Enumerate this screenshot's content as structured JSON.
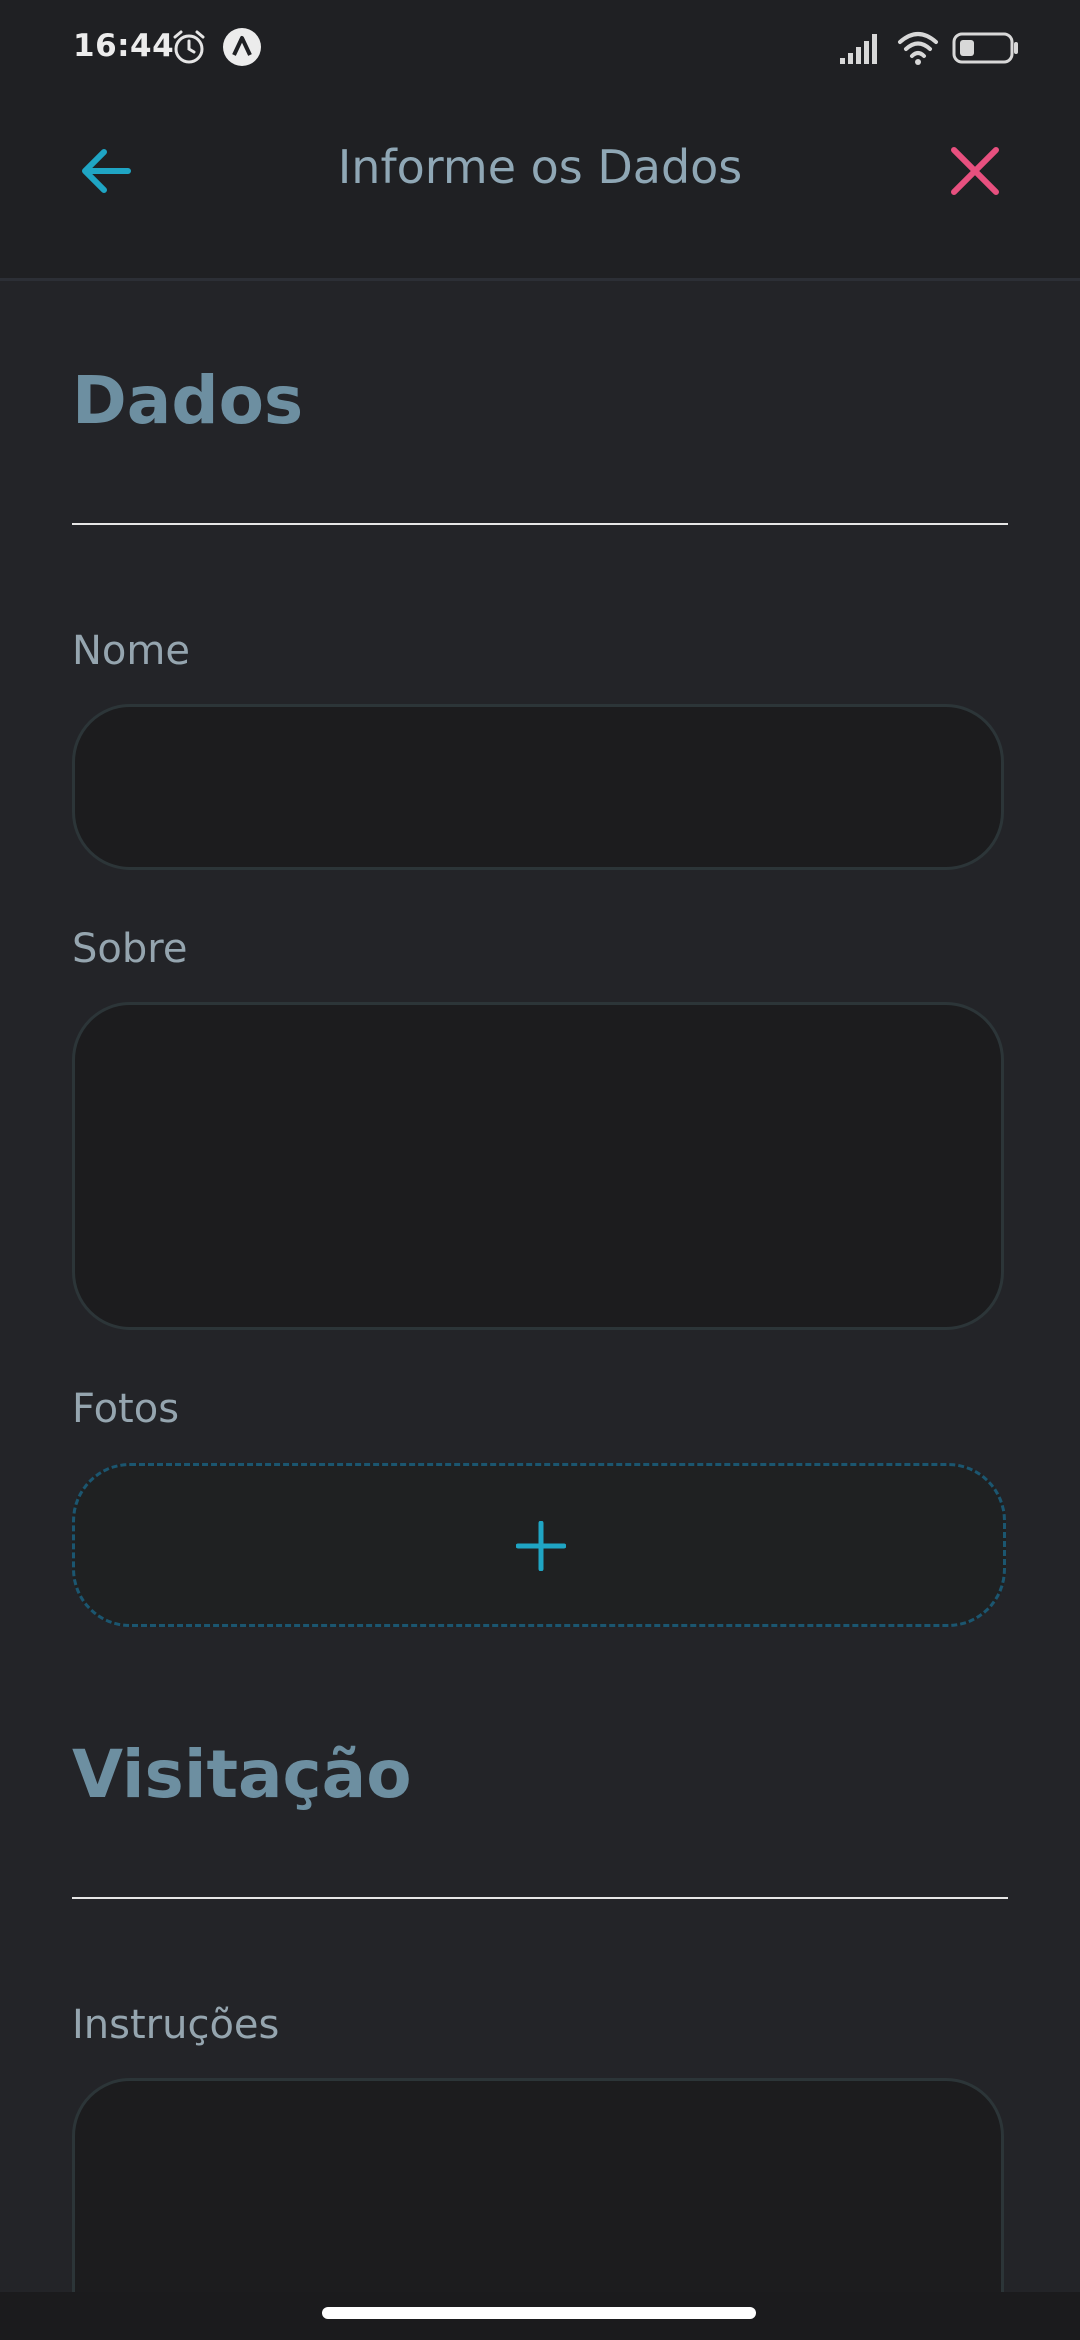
{
  "status_bar": {
    "time": "16:44",
    "icons": [
      "alarm-icon",
      "app-notification-icon",
      "signal-icon",
      "wifi-icon",
      "battery-icon"
    ]
  },
  "header": {
    "title": "Informe os Dados",
    "back_icon": "arrow-left-icon",
    "close_icon": "close-icon"
  },
  "sections": {
    "dados": {
      "title": "Dados",
      "fields": {
        "nome": {
          "label": "Nome",
          "value": ""
        },
        "sobre": {
          "label": "Sobre",
          "value": ""
        },
        "fotos": {
          "label": "Fotos",
          "add_icon": "plus-icon"
        }
      }
    },
    "visitacao": {
      "title": "Visitação",
      "fields": {
        "instrucoes": {
          "label": "Instruções",
          "value": ""
        }
      }
    }
  },
  "colors": {
    "accent": "#1fa5c4",
    "close": "#e8507f",
    "background": "#232428",
    "header_bg": "#1f2023",
    "section_title": "#6d8fa1",
    "label": "#95a5af"
  }
}
